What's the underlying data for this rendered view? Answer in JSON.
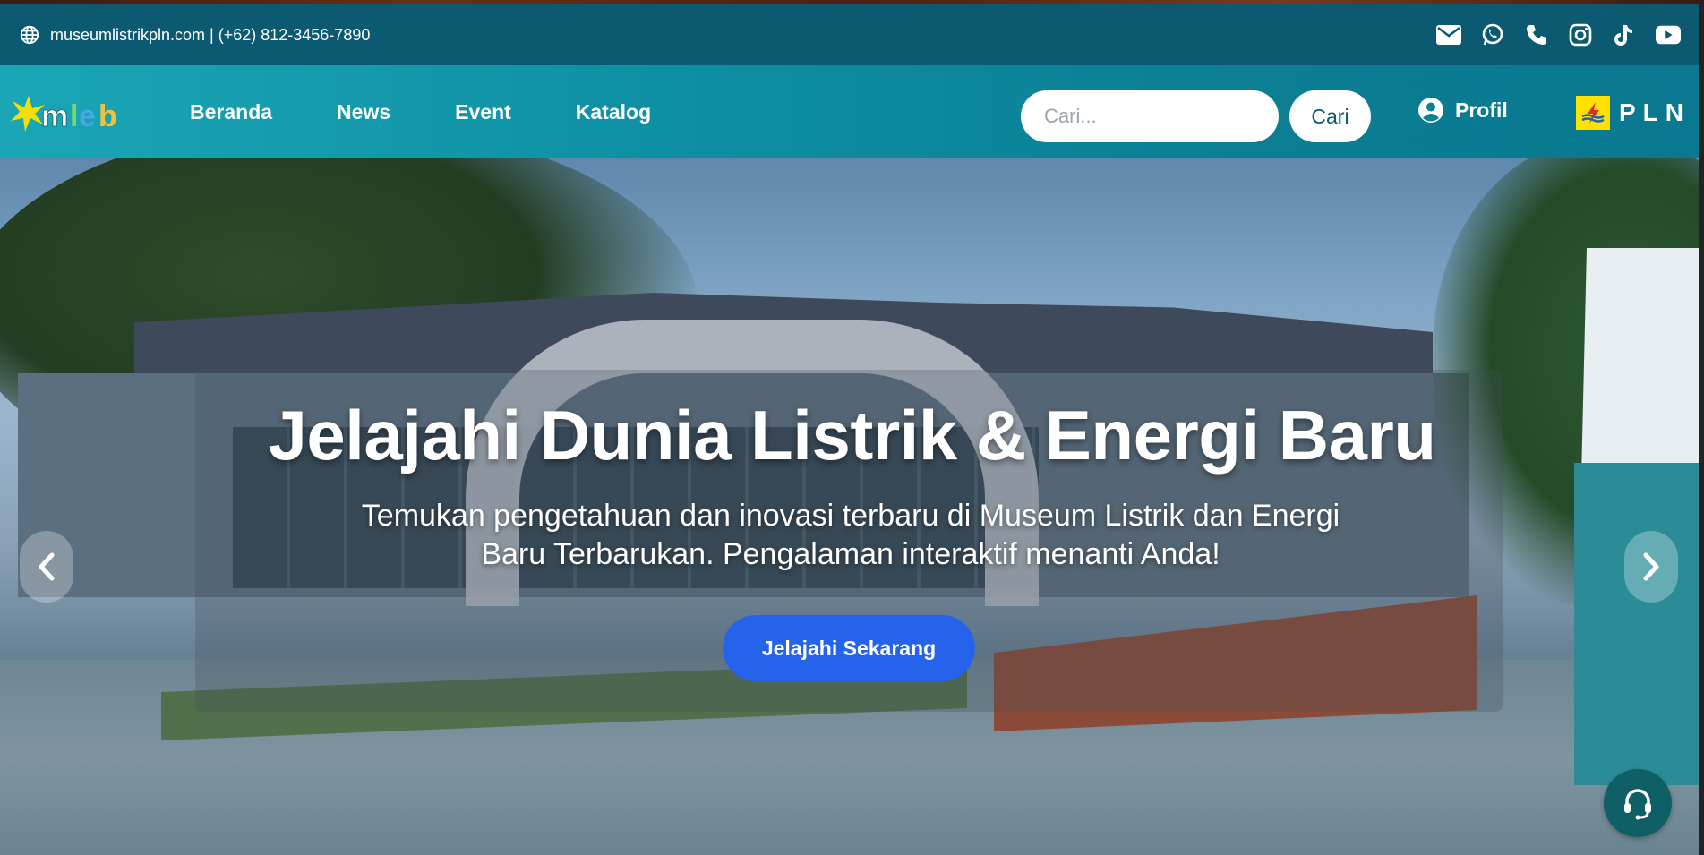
{
  "topbar": {
    "contact": "museumlistrikpln.com | (+62) 812-3456-7890",
    "icons": [
      "globe-icon",
      "mail-icon",
      "whatsapp-icon",
      "phone-icon",
      "instagram-icon",
      "tiktok-icon",
      "youtube-icon"
    ]
  },
  "nav": {
    "logo_text": "mleb",
    "links": [
      "Beranda",
      "News",
      "Event",
      "Katalog"
    ],
    "search_placeholder": "Cari...",
    "search_button": "Cari",
    "profile_label": "Profil",
    "partner_logo": "PLN"
  },
  "hero": {
    "title": "Jelajahi Dunia Listrik & Energi Baru",
    "subtitle": "Temukan pengetahuan dan inovasi terbaru di Museum Listrik dan Energi Baru Terbarukan. Pengalaman interaktif menanti Anda!",
    "cta": "Jelajahi Sekarang",
    "button_color": "#2563eb"
  },
  "colors": {
    "topbar": "#0b5a72",
    "navbar_start": "#1aa6b6",
    "navbar_end": "#0a7890",
    "accent_yellow": "#ffe100",
    "support": "#0f5f66"
  }
}
